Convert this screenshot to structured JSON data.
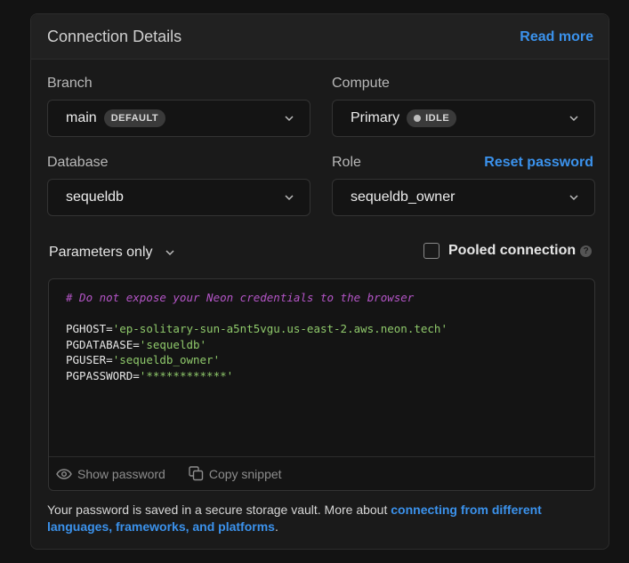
{
  "header": {
    "title": "Connection Details",
    "read_more": "Read more"
  },
  "branch": {
    "label": "Branch",
    "value": "main",
    "badge": "DEFAULT"
  },
  "compute": {
    "label": "Compute",
    "value": "Primary",
    "badge": "IDLE"
  },
  "database": {
    "label": "Database",
    "value": "sequeldb"
  },
  "role": {
    "label": "Role",
    "value": "sequeldb_owner",
    "reset": "Reset password"
  },
  "params": {
    "value": "Parameters only"
  },
  "pooled": {
    "label": "Pooled connection",
    "help": "?"
  },
  "code": {
    "comment": "# Do not expose your Neon credentials to the browser",
    "lines": [
      {
        "key": "PGHOST",
        "value": "'ep-solitary-sun-a5nt5vgu.us-east-2.aws.neon.tech'"
      },
      {
        "key": "PGDATABASE",
        "value": "'sequeldb'"
      },
      {
        "key": "PGUSER",
        "value": "'sequeldb_owner'"
      },
      {
        "key": "PGPASSWORD",
        "value": "'************'"
      }
    ],
    "show_password": "Show password",
    "copy_snippet": "Copy snippet"
  },
  "note": {
    "text": "Your password is saved in a secure storage vault. More about ",
    "link": "connecting from different languages, frameworks, and platforms",
    "end": "."
  },
  "colors": {
    "accent": "#3b92ec",
    "comment": "#b455c7",
    "string": "#8fc96b"
  }
}
